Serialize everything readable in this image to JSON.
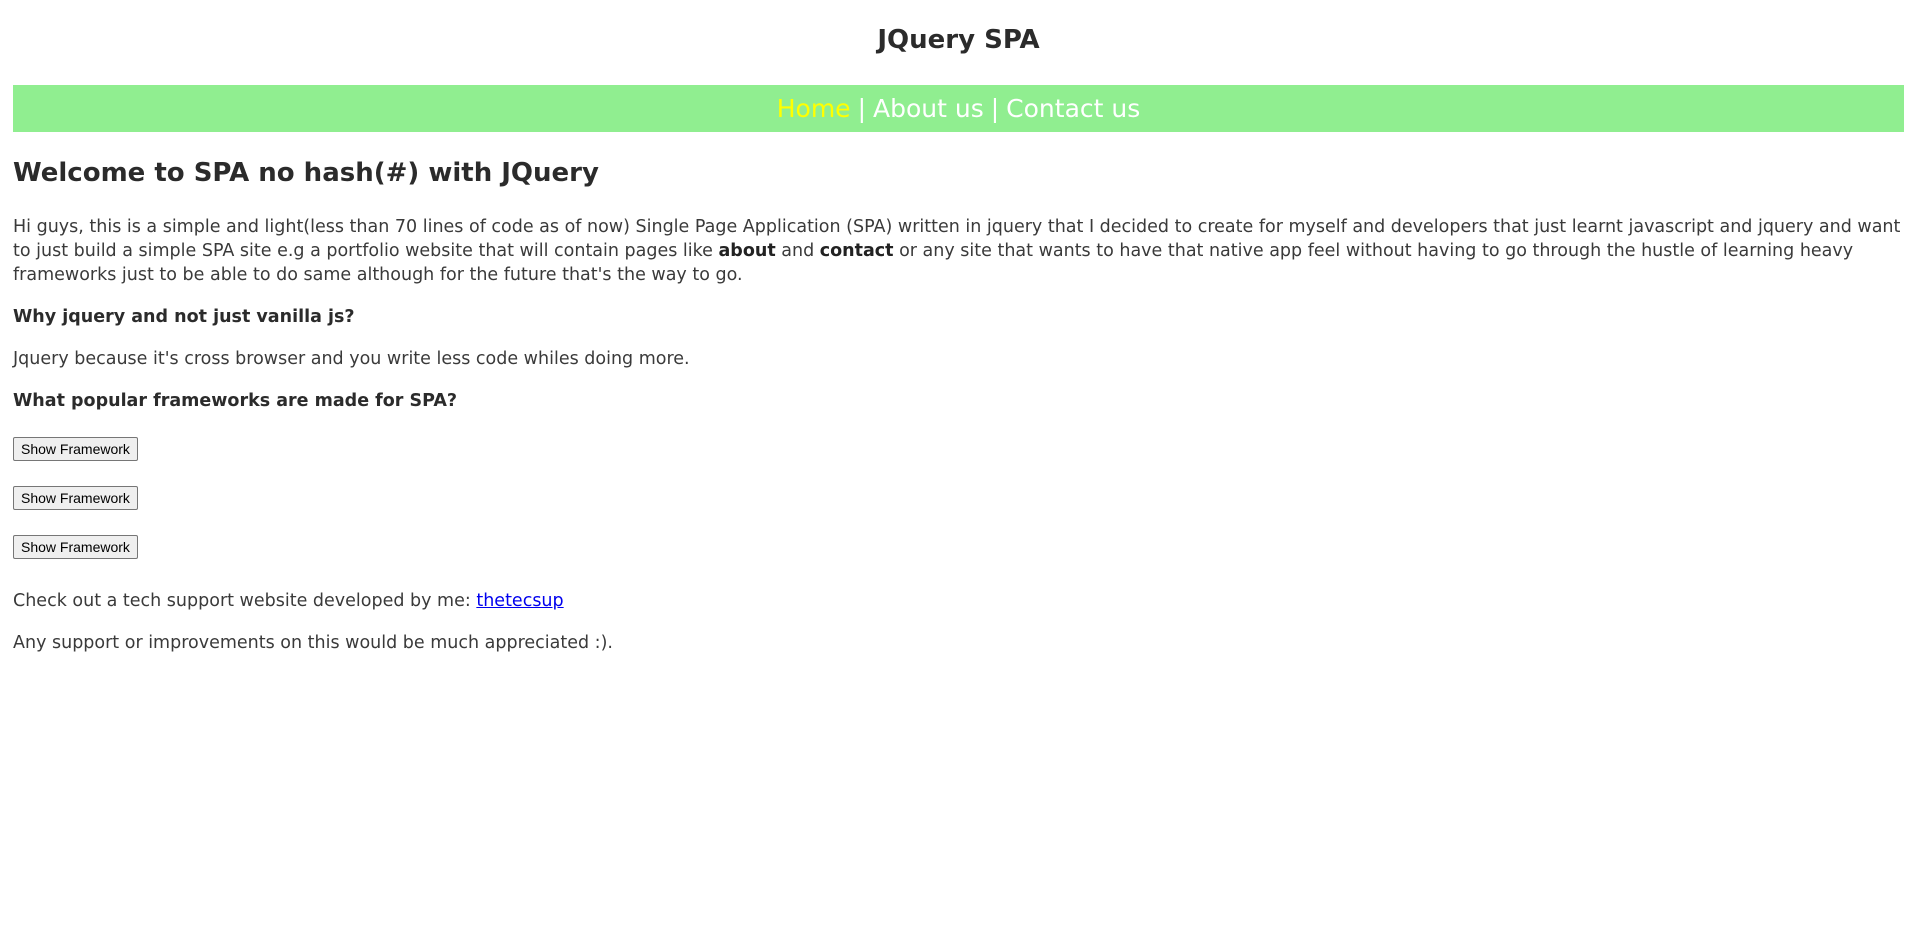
{
  "header": {
    "title": "JQuery SPA"
  },
  "nav": {
    "items": [
      {
        "label": "Home",
        "active": true
      },
      {
        "label": "About us",
        "active": false
      },
      {
        "label": "Contact us",
        "active": false
      }
    ],
    "separator": "|",
    "background": "#90ee90",
    "active_color": "#ffff00"
  },
  "main": {
    "heading": "Welcome to SPA no hash(#) with JQuery",
    "intro": {
      "part1": "Hi guys, this is a simple and light(less than 70 lines of code as of now) Single Page Application (SPA) written in jquery that I decided to create for myself and developers that just learnt javascript and jquery and want to just build a simple SPA site e.g a portfolio website that will contain pages like ",
      "bold1": "about",
      "part2": " and ",
      "bold2": "contact",
      "part3": " or any site that wants to have that native app feel without having to go through the hustle of learning heavy frameworks just to be able to do same although for the future that's the way to go."
    },
    "q1": "Why jquery and not just vanilla js?",
    "a1": "Jquery because it's cross browser and you write less code whiles doing more.",
    "q2": "What popular frameworks are made for SPA?",
    "buttons": [
      {
        "label": "Show Framework"
      },
      {
        "label": "Show Framework"
      },
      {
        "label": "Show Framework"
      }
    ],
    "check_text": "Check out a tech support website developed by me: ",
    "check_link": "thetecsup",
    "support": "Any support or improvements on this would be much appreciated :)."
  }
}
